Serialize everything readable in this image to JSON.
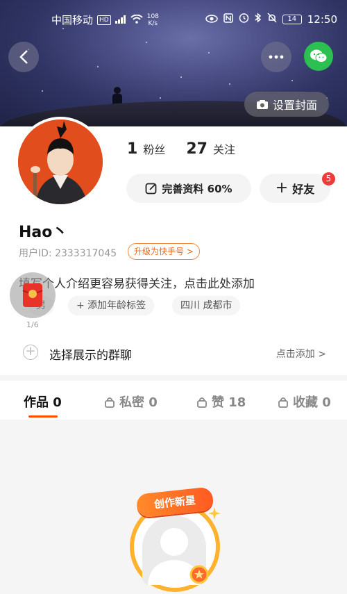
{
  "status_bar": {
    "carrier": "中国移动",
    "hd_badge": "HD",
    "net_speed_value": "108",
    "net_speed_unit": "K/s",
    "battery": "14",
    "time": "12:50"
  },
  "cover": {
    "set_cover_label": "设置封面"
  },
  "profile": {
    "followers_count": "1",
    "followers_label": "粉丝",
    "following_count": "27",
    "following_label": "关注",
    "edit_profile_label": "完善资料 60%",
    "friends_label": "好友",
    "friends_badge": "5",
    "name": "Hao丶",
    "user_id": "用户ID: 2333317045",
    "upgrade_label": "升级为快手号 >",
    "bio_placeholder": "填写个人介绍更容易获得关注，点击此处添加",
    "gender_tag": "男",
    "age_tag": "+ 添加年龄标签",
    "location_tag": "四川 成都市",
    "redpacket_count": "1/6"
  },
  "group_chat": {
    "label": "选择展示的群聊",
    "action": "点击添加 >"
  },
  "tabs": [
    {
      "label": "作品 0",
      "locked": false
    },
    {
      "label": "私密 0",
      "locked": true
    },
    {
      "label": "赞 18",
      "locked": true
    },
    {
      "label": "收藏 0",
      "locked": true
    }
  ],
  "creator_banner": {
    "title": "创作新星"
  },
  "colors": {
    "accent": "#ff5000",
    "wechat": "#2bc04f",
    "badge": "#ee3b3b"
  }
}
